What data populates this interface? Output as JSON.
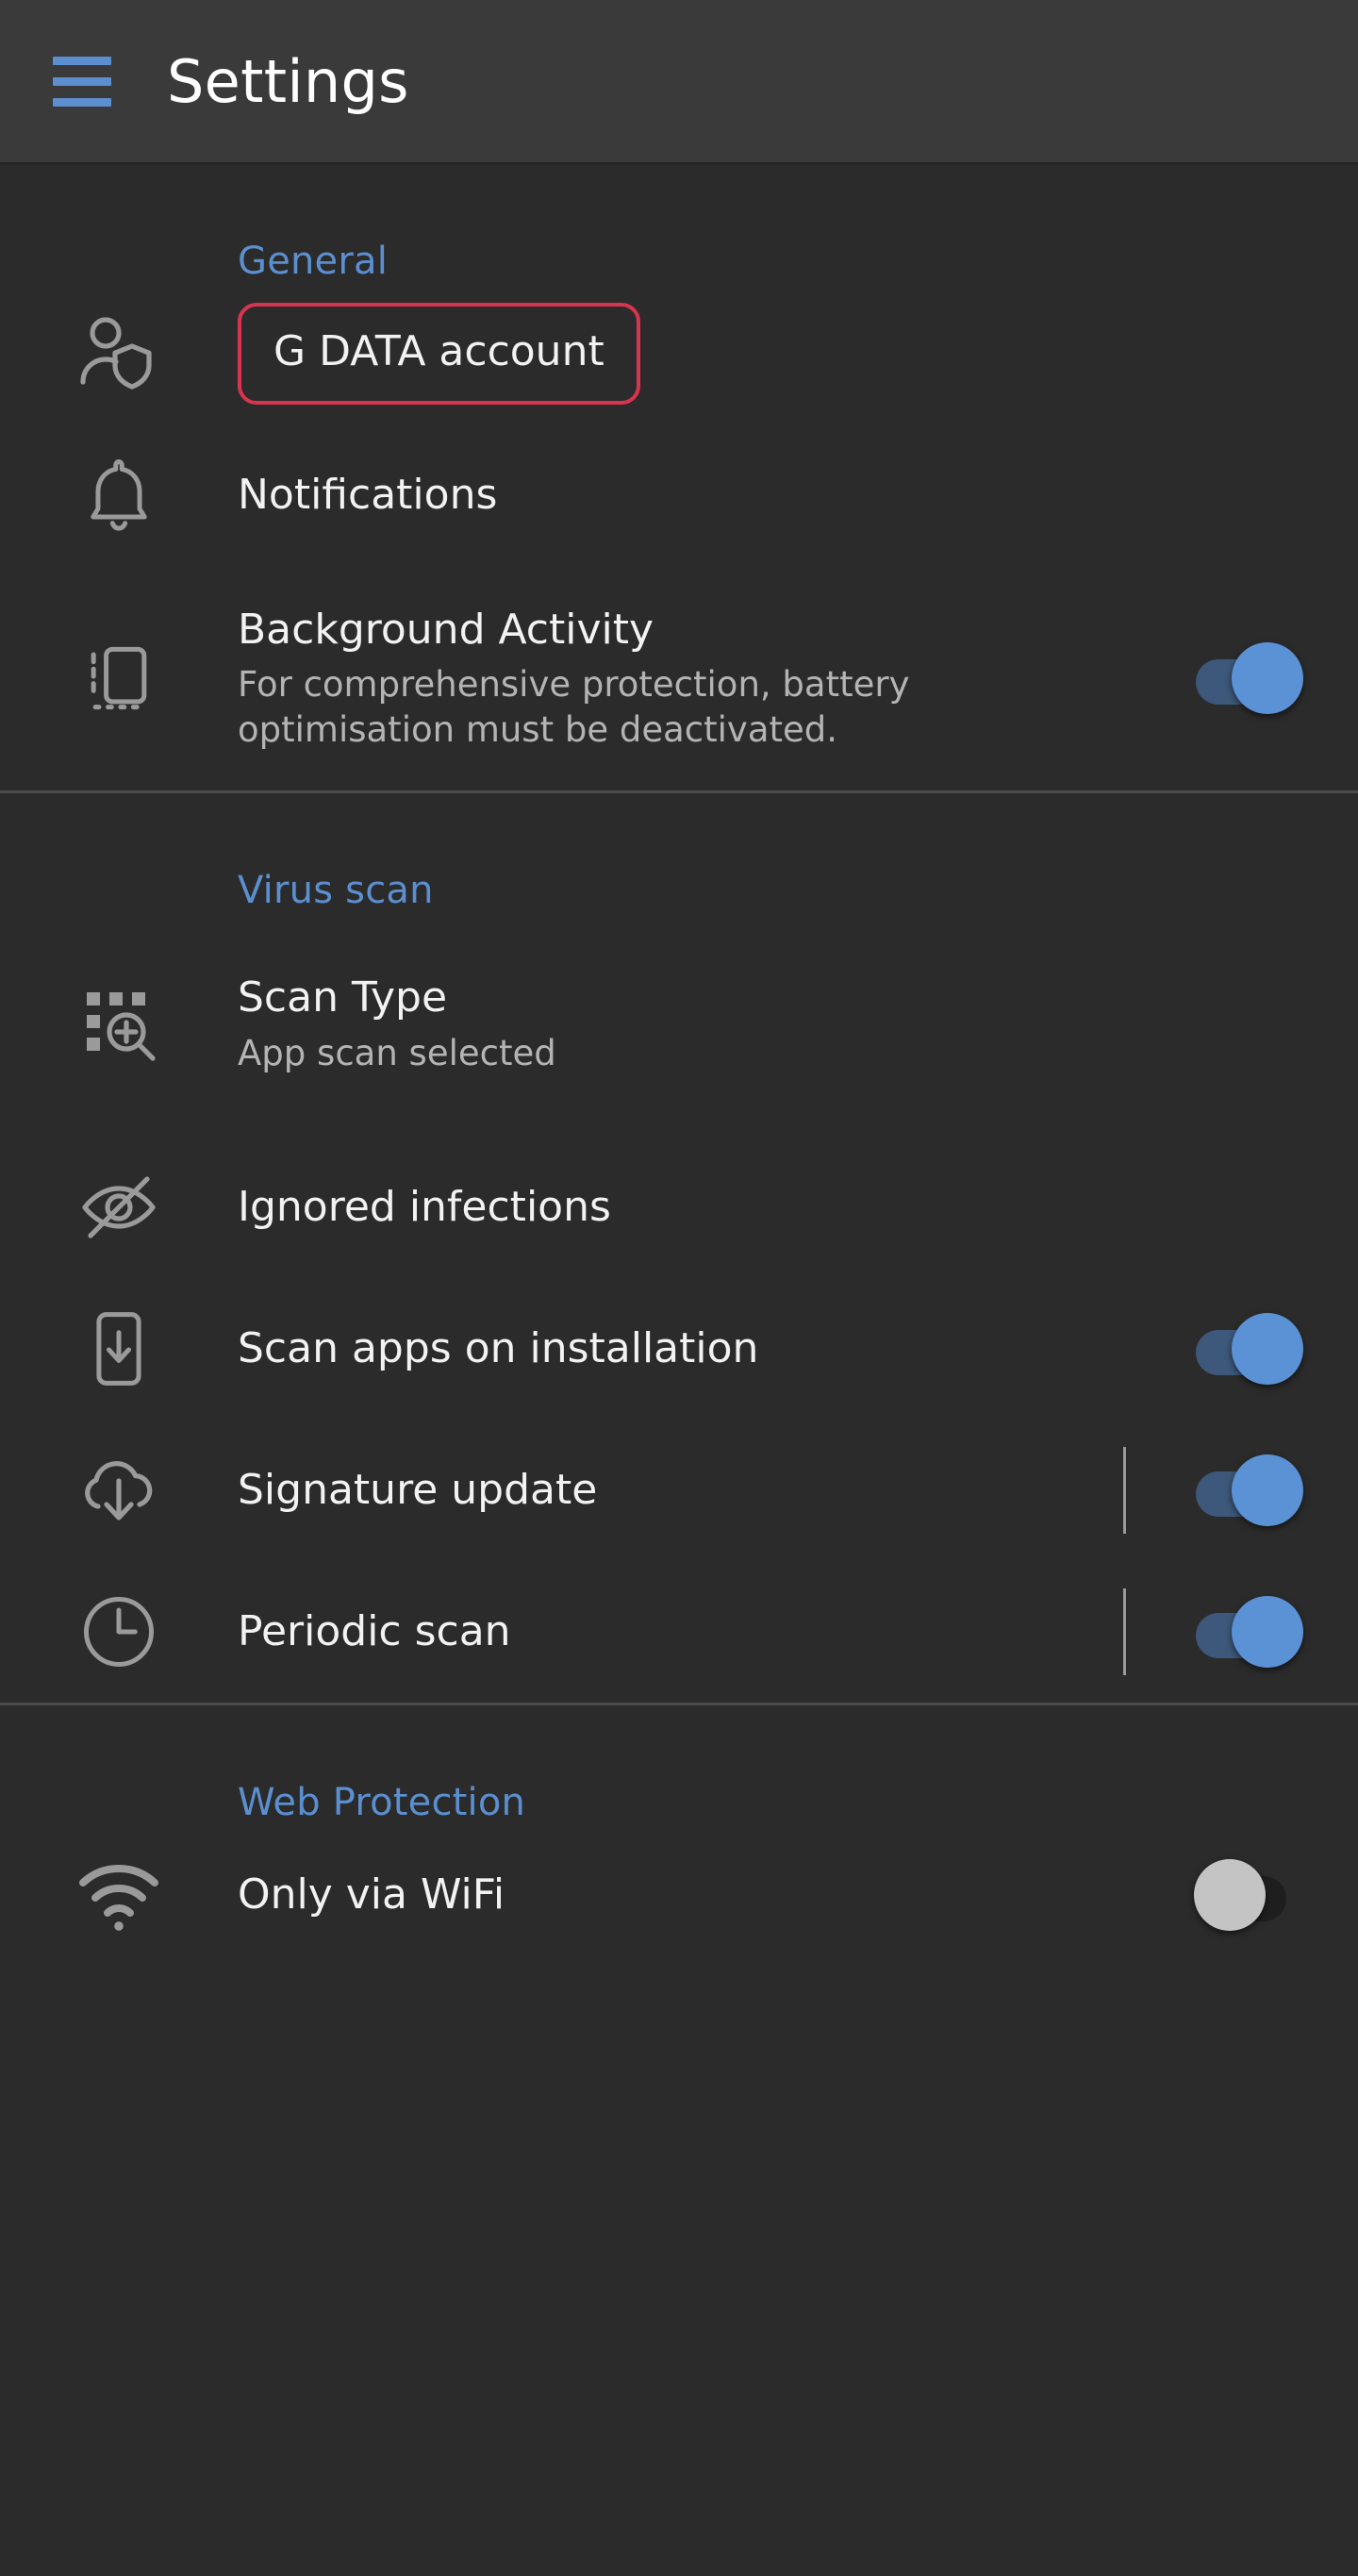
{
  "appbar": {
    "menu_icon": "hamburger-menu-icon",
    "title": "Settings"
  },
  "accent_colors": {
    "section_header": "#5b8fd0",
    "menu_icon": "#5b8fd0",
    "highlight_outline": "#d8344f",
    "switch_on_track": "#3d587a",
    "switch_on_thumb": "#5b92d6",
    "switch_off_track": "#1e1e1e",
    "switch_off_thumb": "#c4c4c4",
    "background": "#2b2b2b",
    "appbar_background": "#3a3a3a",
    "primary_text": "#f2f2f2",
    "secondary_text": "#b4b4b4",
    "icon": "#9a9a9a"
  },
  "sections": [
    {
      "title": "General",
      "rows": [
        {
          "icon": "account-shield-icon",
          "title": "G DATA account",
          "subtitle": "",
          "highlighted": true,
          "switch": null,
          "divider": false
        },
        {
          "icon": "bell-icon",
          "title": "Notifications",
          "subtitle": "",
          "highlighted": false,
          "switch": null,
          "divider": false
        },
        {
          "icon": "background-activity-icon",
          "title": "Background Activity",
          "subtitle": "For comprehensive protection, battery optimisation must be deactivated.",
          "highlighted": false,
          "switch": "on",
          "divider": false
        }
      ]
    },
    {
      "title": "Virus scan",
      "rows": [
        {
          "icon": "scan-type-icon",
          "title": "Scan Type",
          "subtitle": "App scan selected",
          "highlighted": false,
          "switch": null,
          "divider": false
        },
        {
          "icon": "eye-off-icon",
          "title": "Ignored infections",
          "subtitle": "",
          "highlighted": false,
          "switch": null,
          "divider": false
        },
        {
          "icon": "phone-download-icon",
          "title": "Scan apps on installation",
          "subtitle": "",
          "highlighted": false,
          "switch": "on",
          "divider": false
        },
        {
          "icon": "cloud-download-icon",
          "title": "Signature update",
          "subtitle": "",
          "highlighted": false,
          "switch": "on",
          "divider": true
        },
        {
          "icon": "clock-icon",
          "title": "Periodic scan",
          "subtitle": "",
          "highlighted": false,
          "switch": "on",
          "divider": true
        }
      ]
    },
    {
      "title": "Web Protection",
      "rows": [
        {
          "icon": "wifi-icon",
          "title": "Only via WiFi",
          "subtitle": "",
          "highlighted": false,
          "switch": "off",
          "divider": false
        }
      ]
    }
  ]
}
